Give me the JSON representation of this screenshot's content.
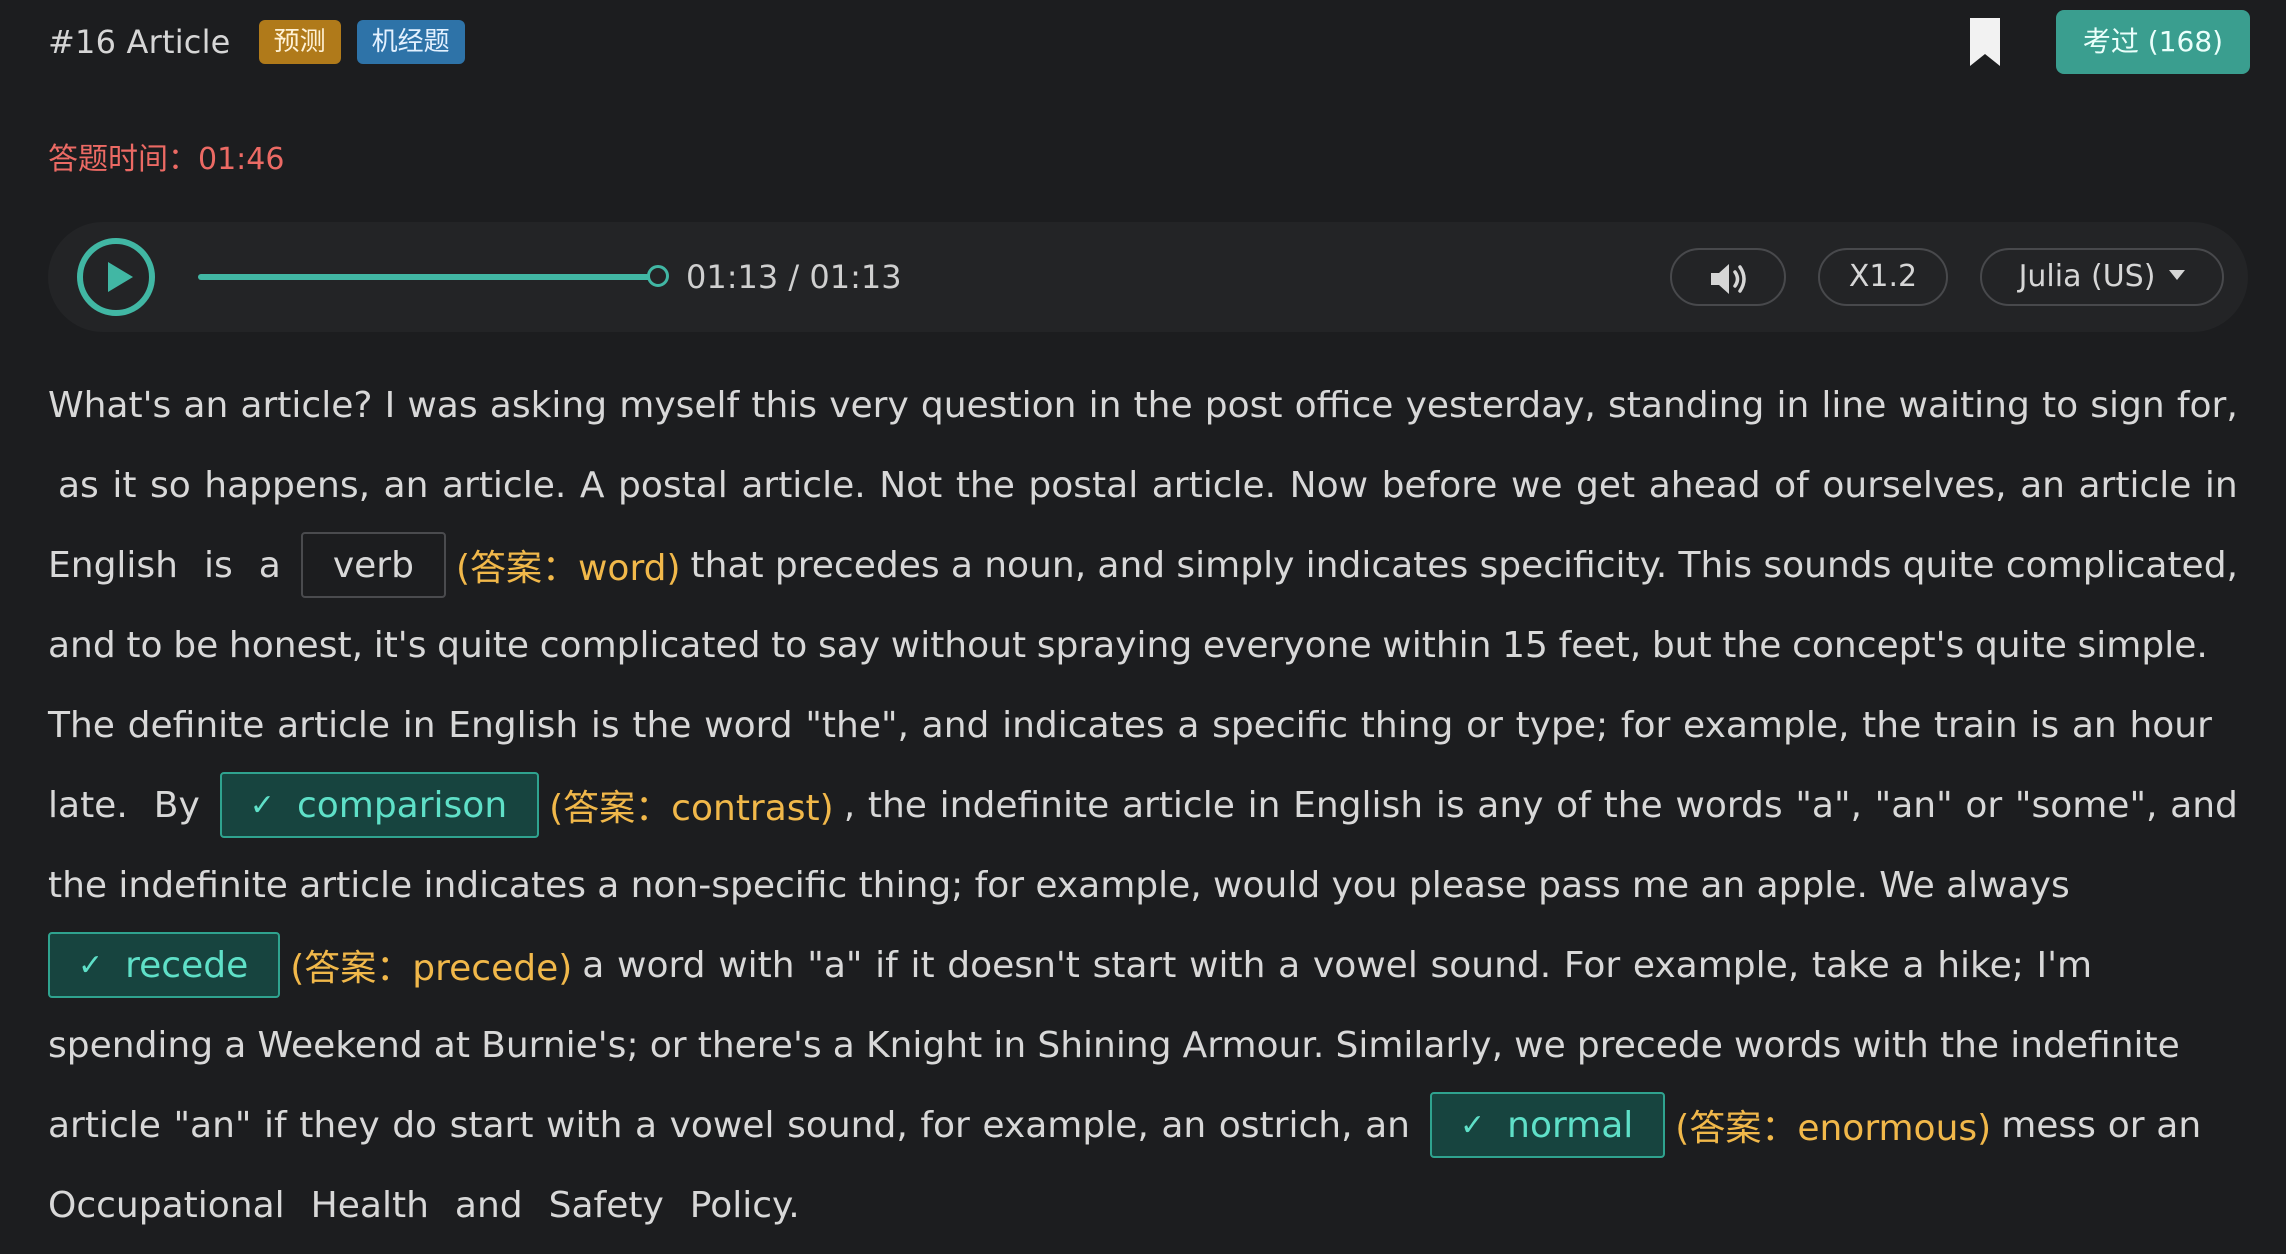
{
  "header": {
    "title": "#16 Article",
    "tags": [
      "预测",
      "机经题"
    ],
    "taken_button": "考过 (168)"
  },
  "timer": {
    "text": "答题时间：01:46"
  },
  "player": {
    "progress": 1.0,
    "time_readout": "01:13 / 01:13",
    "speed": "X1.2",
    "voice": "Julia (US)"
  },
  "article": {
    "l1": [
      "What's",
      "an",
      "article?",
      "I",
      "was",
      "asking",
      "myself",
      "this",
      "very",
      "question",
      "in",
      "the",
      "post",
      "office",
      "yesterday,",
      "standing",
      "in",
      "line",
      "waiting",
      "to",
      "sign",
      "for,"
    ],
    "l2": [
      "as",
      "it",
      "so",
      "happens,",
      "an",
      "article.",
      "A",
      "postal",
      "article.",
      "Not",
      "the",
      "postal",
      "article.",
      "Now",
      "before",
      "we",
      "get",
      "ahead",
      "of",
      "ourselves,",
      "an",
      "article",
      "in"
    ],
    "l3_pre": [
      "English",
      "is",
      "a"
    ],
    "l3_post": [
      "that",
      "precedes",
      "a",
      "noun,",
      "and",
      "simply",
      "indicates",
      "specificity.",
      "This",
      "sounds",
      "quite",
      "complicated,"
    ],
    "l4": [
      "and",
      "to",
      "be",
      "honest,",
      "it's",
      "quite",
      "complicated",
      "to",
      "say",
      "without",
      "spraying",
      "everyone",
      "within",
      "15",
      "feet,",
      "but",
      "the",
      "concept's",
      "quite",
      "simple."
    ],
    "l5": [
      "The",
      "definite",
      "article",
      "in",
      "English",
      "is",
      "the",
      "word",
      "\"the\",",
      "and",
      "indicates",
      "a",
      "specific",
      "thing",
      "or",
      "type;",
      "for",
      "example,",
      "the",
      "train",
      "is",
      "an",
      "hour"
    ],
    "l6_pre": [
      "late.",
      "By"
    ],
    "l6_post": [
      ",",
      "the",
      "indefinite",
      "article",
      "in",
      "English",
      "is",
      "any",
      "of",
      "the",
      "words",
      "\"a\",",
      "\"an\"",
      "or",
      "\"some\",",
      "and"
    ],
    "l7": [
      "the",
      "indefinite",
      "article",
      "indicates",
      "a",
      "non-specific",
      "thing;",
      "for",
      "example,",
      "would",
      "you",
      "please",
      "pass",
      "me",
      "an",
      "apple.",
      "We",
      "always"
    ],
    "l8_post": [
      "a",
      "word",
      "with",
      "\"a\"",
      "if",
      "it",
      "doesn't",
      "start",
      "with",
      "a",
      "vowel",
      "sound.",
      "For",
      "example,",
      "take",
      "a",
      "hike;",
      "I'm"
    ],
    "l9": [
      "spending",
      "a",
      "Weekend",
      "at",
      "Burnie's;",
      "or",
      "there's",
      "a",
      "Knight",
      "in",
      "Shining",
      "Armour.",
      "Similarly,",
      "we",
      "precede",
      "words",
      "with",
      "the",
      "indefinite"
    ],
    "l10_pre": [
      "article",
      "\"an\"",
      "if",
      "they",
      "do",
      "start",
      "with",
      "a",
      "vowel",
      "sound,",
      "for",
      "example,",
      "an",
      "ostrich,",
      "an"
    ],
    "l10_post": [
      "mess",
      "or",
      "an"
    ],
    "l11": [
      "Occupational",
      "Health",
      "and",
      "Safety",
      "Policy."
    ],
    "blanks": [
      {
        "value": "verb",
        "check": "",
        "answer": "(答案：word)"
      },
      {
        "value": "comparison",
        "check": "✓",
        "answer": "(答案：contrast)"
      },
      {
        "value": "recede",
        "check": "✓",
        "answer": "(答案：precede)"
      },
      {
        "value": "normal",
        "check": "✓",
        "answer": "(答案：enormous)"
      }
    ]
  },
  "colors": {
    "background": "#1c1d1f",
    "accent": "#41b7a4",
    "timer": "#ec6a64",
    "answer": "#f1b84a",
    "correct_fill": "#17443f"
  },
  "icons": {
    "play": "play-icon",
    "bookmark": "bookmark-icon",
    "volume": "volume-icon",
    "dropdown": "chevron-down-icon",
    "check": "check-icon"
  }
}
